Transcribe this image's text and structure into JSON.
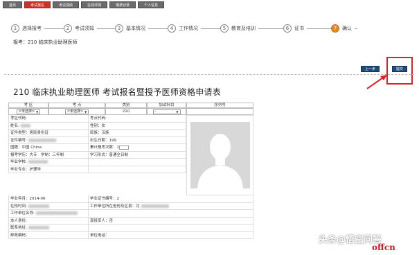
{
  "nav": {
    "tabs": [
      "首页",
      "考试报名",
      "考试成绩",
      "在线评测",
      "缴费记录",
      "个人信息"
    ],
    "active_index": 1
  },
  "steps": [
    {
      "num": "1",
      "label": "选择报考"
    },
    {
      "num": "2",
      "label": "考试须知"
    },
    {
      "num": "3",
      "label": "基本情况"
    },
    {
      "num": "4",
      "label": "工作情况"
    },
    {
      "num": "5",
      "label": "教育及培训"
    },
    {
      "num": "6",
      "label": "证书"
    },
    {
      "num": "7",
      "label": "确认"
    }
  ],
  "subtitle": "报考：210 临床执业助理医师",
  "buttons": {
    "prev": "上一步",
    "submit": "提交"
  },
  "form_title": "210 临床执业助理医师 考试报名暨授予医师资格申请表",
  "table": {
    "headers": [
      "考 区",
      "考 点",
      "类别",
      "加试科目",
      "序列号"
    ],
    "select_values": [
      "<未选择>",
      "<未选择>",
      "210",
      "-"
    ],
    "left_rows": [
      [
        "考区代码:",
        "考点代码:"
      ],
      [
        "姓名:",
        "性别：女"
      ],
      [
        "证件类型：居民身份证",
        "民族：汉族"
      ],
      [
        "证件编号:",
        "出生日期：199"
      ],
      [
        "国籍：中国 China",
        "累计报考次数：1"
      ],
      [
        "报考学历：大专　学制：三年制",
        "学习形式：普通全日制"
      ],
      [
        "毕业学校:",
        ""
      ],
      [
        "毕业专业：护理学",
        ""
      ]
    ],
    "full_rows": [
      [
        "毕业年月：2014-06",
        "毕业证书编号：2"
      ],
      [
        "在校时间:",
        "工作单位所在省份及区县：北"
      ],
      [
        "工作单位名称:",
        ""
      ],
      [
        "本人身份:",
        "现役军人：否"
      ],
      [
        "联系地址:",
        ""
      ],
      [
        "邮政编码：",
        "单位电话："
      ]
    ]
  },
  "watermark": "头条@悟空问答",
  "brand": "offcn",
  "colors": {
    "active_tab": "#c8322a",
    "current_step": "#e38a1e",
    "button": "#1d4c7a",
    "highlight": "#e02020"
  }
}
